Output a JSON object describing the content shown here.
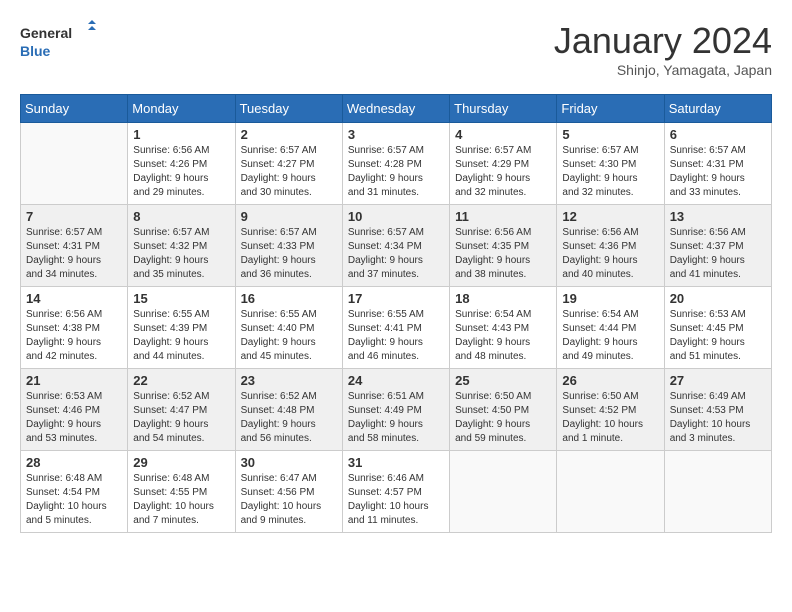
{
  "header": {
    "logo_line1": "General",
    "logo_line2": "Blue",
    "month_title": "January 2024",
    "subtitle": "Shinjo, Yamagata, Japan"
  },
  "days_of_week": [
    "Sunday",
    "Monday",
    "Tuesday",
    "Wednesday",
    "Thursday",
    "Friday",
    "Saturday"
  ],
  "weeks": [
    [
      {
        "date": "",
        "info": ""
      },
      {
        "date": "1",
        "info": "Sunrise: 6:56 AM\nSunset: 4:26 PM\nDaylight: 9 hours\nand 29 minutes."
      },
      {
        "date": "2",
        "info": "Sunrise: 6:57 AM\nSunset: 4:27 PM\nDaylight: 9 hours\nand 30 minutes."
      },
      {
        "date": "3",
        "info": "Sunrise: 6:57 AM\nSunset: 4:28 PM\nDaylight: 9 hours\nand 31 minutes."
      },
      {
        "date": "4",
        "info": "Sunrise: 6:57 AM\nSunset: 4:29 PM\nDaylight: 9 hours\nand 32 minutes."
      },
      {
        "date": "5",
        "info": "Sunrise: 6:57 AM\nSunset: 4:30 PM\nDaylight: 9 hours\nand 32 minutes."
      },
      {
        "date": "6",
        "info": "Sunrise: 6:57 AM\nSunset: 4:31 PM\nDaylight: 9 hours\nand 33 minutes."
      }
    ],
    [
      {
        "date": "7",
        "info": "Sunrise: 6:57 AM\nSunset: 4:31 PM\nDaylight: 9 hours\nand 34 minutes."
      },
      {
        "date": "8",
        "info": "Sunrise: 6:57 AM\nSunset: 4:32 PM\nDaylight: 9 hours\nand 35 minutes."
      },
      {
        "date": "9",
        "info": "Sunrise: 6:57 AM\nSunset: 4:33 PM\nDaylight: 9 hours\nand 36 minutes."
      },
      {
        "date": "10",
        "info": "Sunrise: 6:57 AM\nSunset: 4:34 PM\nDaylight: 9 hours\nand 37 minutes."
      },
      {
        "date": "11",
        "info": "Sunrise: 6:56 AM\nSunset: 4:35 PM\nDaylight: 9 hours\nand 38 minutes."
      },
      {
        "date": "12",
        "info": "Sunrise: 6:56 AM\nSunset: 4:36 PM\nDaylight: 9 hours\nand 40 minutes."
      },
      {
        "date": "13",
        "info": "Sunrise: 6:56 AM\nSunset: 4:37 PM\nDaylight: 9 hours\nand 41 minutes."
      }
    ],
    [
      {
        "date": "14",
        "info": "Sunrise: 6:56 AM\nSunset: 4:38 PM\nDaylight: 9 hours\nand 42 minutes."
      },
      {
        "date": "15",
        "info": "Sunrise: 6:55 AM\nSunset: 4:39 PM\nDaylight: 9 hours\nand 44 minutes."
      },
      {
        "date": "16",
        "info": "Sunrise: 6:55 AM\nSunset: 4:40 PM\nDaylight: 9 hours\nand 45 minutes."
      },
      {
        "date": "17",
        "info": "Sunrise: 6:55 AM\nSunset: 4:41 PM\nDaylight: 9 hours\nand 46 minutes."
      },
      {
        "date": "18",
        "info": "Sunrise: 6:54 AM\nSunset: 4:43 PM\nDaylight: 9 hours\nand 48 minutes."
      },
      {
        "date": "19",
        "info": "Sunrise: 6:54 AM\nSunset: 4:44 PM\nDaylight: 9 hours\nand 49 minutes."
      },
      {
        "date": "20",
        "info": "Sunrise: 6:53 AM\nSunset: 4:45 PM\nDaylight: 9 hours\nand 51 minutes."
      }
    ],
    [
      {
        "date": "21",
        "info": "Sunrise: 6:53 AM\nSunset: 4:46 PM\nDaylight: 9 hours\nand 53 minutes."
      },
      {
        "date": "22",
        "info": "Sunrise: 6:52 AM\nSunset: 4:47 PM\nDaylight: 9 hours\nand 54 minutes."
      },
      {
        "date": "23",
        "info": "Sunrise: 6:52 AM\nSunset: 4:48 PM\nDaylight: 9 hours\nand 56 minutes."
      },
      {
        "date": "24",
        "info": "Sunrise: 6:51 AM\nSunset: 4:49 PM\nDaylight: 9 hours\nand 58 minutes."
      },
      {
        "date": "25",
        "info": "Sunrise: 6:50 AM\nSunset: 4:50 PM\nDaylight: 9 hours\nand 59 minutes."
      },
      {
        "date": "26",
        "info": "Sunrise: 6:50 AM\nSunset: 4:52 PM\nDaylight: 10 hours\nand 1 minute."
      },
      {
        "date": "27",
        "info": "Sunrise: 6:49 AM\nSunset: 4:53 PM\nDaylight: 10 hours\nand 3 minutes."
      }
    ],
    [
      {
        "date": "28",
        "info": "Sunrise: 6:48 AM\nSunset: 4:54 PM\nDaylight: 10 hours\nand 5 minutes."
      },
      {
        "date": "29",
        "info": "Sunrise: 6:48 AM\nSunset: 4:55 PM\nDaylight: 10 hours\nand 7 minutes."
      },
      {
        "date": "30",
        "info": "Sunrise: 6:47 AM\nSunset: 4:56 PM\nDaylight: 10 hours\nand 9 minutes."
      },
      {
        "date": "31",
        "info": "Sunrise: 6:46 AM\nSunset: 4:57 PM\nDaylight: 10 hours\nand 11 minutes."
      },
      {
        "date": "",
        "info": ""
      },
      {
        "date": "",
        "info": ""
      },
      {
        "date": "",
        "info": ""
      }
    ]
  ]
}
